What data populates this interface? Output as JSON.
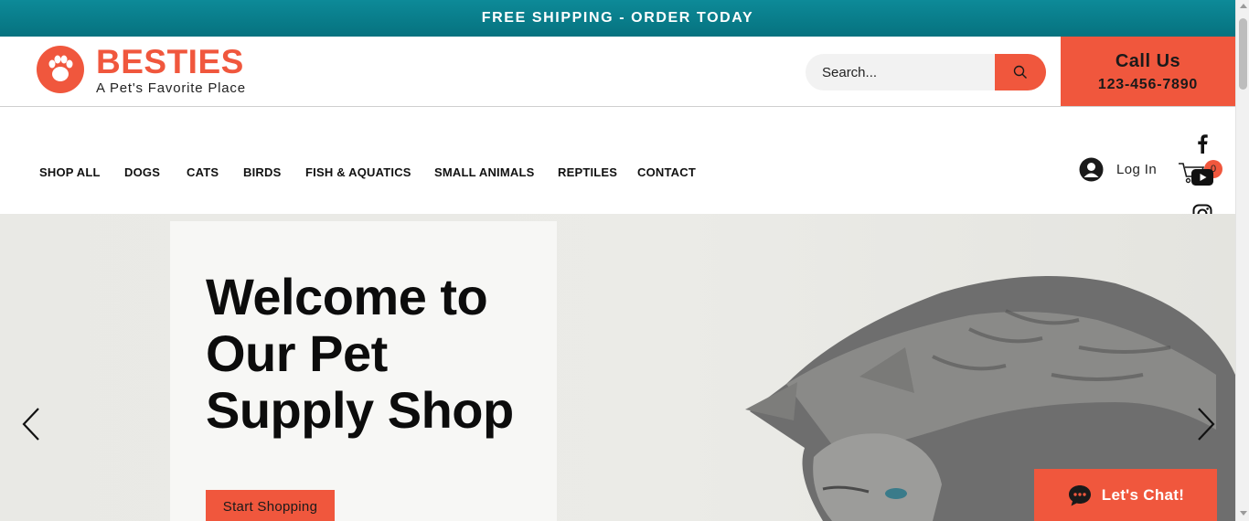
{
  "promo_bar": {
    "text": "FREE SHIPPING - ORDER TODAY"
  },
  "header": {
    "brand": "BESTIES",
    "tagline": "A Pet's Favorite Place",
    "search": {
      "placeholder": "Search..."
    },
    "call": {
      "title": "Call Us",
      "phone": "123-456-7890"
    }
  },
  "nav": {
    "items": [
      {
        "label": "SHOP ALL"
      },
      {
        "label": "DOGS"
      },
      {
        "label": "CATS"
      },
      {
        "label": "BIRDS"
      },
      {
        "label": "FISH & AQUATICS"
      },
      {
        "label": "SMALL ANIMALS"
      },
      {
        "label": "REPTILES"
      },
      {
        "label": "CONTACT"
      }
    ],
    "login_label": "Log In",
    "cart_count": "0"
  },
  "social": {
    "icons": [
      "facebook-icon",
      "youtube-icon",
      "instagram-icon"
    ]
  },
  "hero": {
    "title": "Welcome to Our Pet Supply Shop",
    "cta": "Start Shopping"
  },
  "chat": {
    "label": "Let's Chat!"
  },
  "colors": {
    "accent": "#f0573d",
    "topbar": "#0d8a98",
    "hero_bg": "#e6e6e1"
  }
}
